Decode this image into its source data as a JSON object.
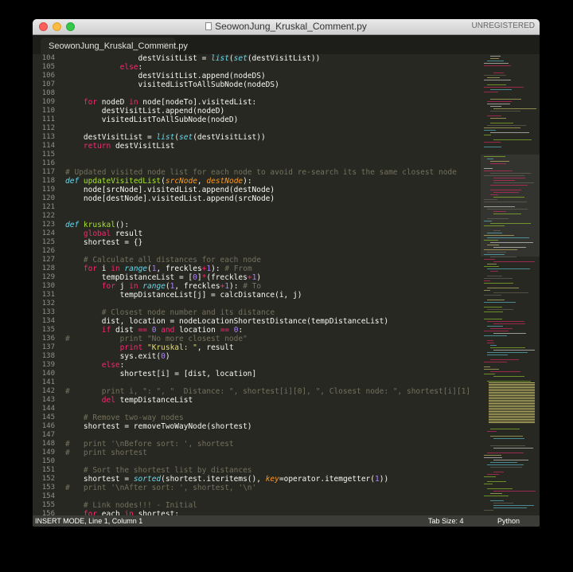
{
  "window": {
    "title": "SeowonJung_Kruskal_Comment.py",
    "unregistered": "UNREGISTERED"
  },
  "tab": {
    "label": "SeowonJung_Kruskal_Comment.py",
    "close_glyph": "×"
  },
  "editor": {
    "theme_colors": {
      "background": "#272822",
      "keyword": "#f92672",
      "function": "#a6e22e",
      "string": "#e6db74",
      "number": "#ae81ff",
      "builtin": "#66d9ef",
      "param": "#fd971f",
      "comment": "#75715e",
      "text": "#f8f8f2"
    },
    "lines": [
      {
        "num": "104",
        "indent": "                ",
        "tokens": [
          [
            "destVisitList = ",
            ""
          ],
          [
            "list",
            "b"
          ],
          [
            "(",
            ""
          ],
          [
            "set",
            "b"
          ],
          [
            "(destVisitList))",
            ""
          ]
        ]
      },
      {
        "num": "105",
        "indent": "            ",
        "tokens": [
          [
            "else",
            "k"
          ],
          [
            ":",
            ""
          ]
        ]
      },
      {
        "num": "106",
        "indent": "                ",
        "tokens": [
          [
            "destVisitList.append(nodeDS)",
            ""
          ]
        ]
      },
      {
        "num": "107",
        "indent": "                ",
        "tokens": [
          [
            "visitedListToAllSubNode(nodeDS)",
            ""
          ]
        ]
      },
      {
        "num": "108",
        "indent": "",
        "tokens": []
      },
      {
        "num": "109",
        "indent": "    ",
        "tokens": [
          [
            "for",
            "k"
          ],
          [
            " nodeD ",
            ""
          ],
          [
            "in",
            "k"
          ],
          [
            " node[nodeTo].visitedList:",
            ""
          ]
        ]
      },
      {
        "num": "110",
        "indent": "        ",
        "tokens": [
          [
            "destVisitList.append(nodeD)",
            ""
          ]
        ]
      },
      {
        "num": "111",
        "indent": "        ",
        "tokens": [
          [
            "visitedListToAllSubNode(nodeD)",
            ""
          ]
        ]
      },
      {
        "num": "112",
        "indent": "",
        "tokens": []
      },
      {
        "num": "113",
        "indent": "    ",
        "tokens": [
          [
            "destVisitList = ",
            ""
          ],
          [
            "list",
            "b"
          ],
          [
            "(",
            ""
          ],
          [
            "set",
            "b"
          ],
          [
            "(destVisitList))",
            ""
          ]
        ]
      },
      {
        "num": "114",
        "indent": "    ",
        "tokens": [
          [
            "return",
            "k"
          ],
          [
            " destVisitList",
            ""
          ]
        ]
      },
      {
        "num": "115",
        "indent": "",
        "tokens": []
      },
      {
        "num": "116",
        "indent": "",
        "tokens": []
      },
      {
        "num": "117",
        "indent": "",
        "tokens": [
          [
            "# Updated visited node list for each node to avoid re-search its the same closest node",
            "c"
          ]
        ]
      },
      {
        "num": "118",
        "indent": "",
        "tokens": [
          [
            "def",
            "b"
          ],
          [
            " ",
            ""
          ],
          [
            "updateVisitedList",
            "f"
          ],
          [
            "(",
            ""
          ],
          [
            "srcNode",
            "p"
          ],
          [
            ", ",
            ""
          ],
          [
            "destNode",
            "p"
          ],
          [
            "):",
            ""
          ]
        ]
      },
      {
        "num": "119",
        "indent": "    ",
        "tokens": [
          [
            "node[srcNode].visitedList.append(destNode)",
            ""
          ]
        ]
      },
      {
        "num": "120",
        "indent": "    ",
        "tokens": [
          [
            "node[destNode].visitedList.append(srcNode)",
            ""
          ]
        ]
      },
      {
        "num": "121",
        "indent": "",
        "tokens": []
      },
      {
        "num": "122",
        "indent": "",
        "tokens": []
      },
      {
        "num": "123",
        "indent": "",
        "tokens": [
          [
            "def",
            "b"
          ],
          [
            " ",
            ""
          ],
          [
            "kruskal",
            "f"
          ],
          [
            "():",
            ""
          ]
        ]
      },
      {
        "num": "124",
        "indent": "    ",
        "tokens": [
          [
            "global",
            "k"
          ],
          [
            " result",
            ""
          ]
        ]
      },
      {
        "num": "125",
        "indent": "    ",
        "tokens": [
          [
            "shortest = {}",
            ""
          ]
        ]
      },
      {
        "num": "126",
        "indent": "",
        "tokens": []
      },
      {
        "num": "127",
        "indent": "    ",
        "tokens": [
          [
            "# Calculate all distances for each node",
            "c"
          ]
        ]
      },
      {
        "num": "128",
        "indent": "    ",
        "tokens": [
          [
            "for",
            "k"
          ],
          [
            " i ",
            ""
          ],
          [
            "in",
            "k"
          ],
          [
            " ",
            ""
          ],
          [
            "range",
            "b"
          ],
          [
            "(",
            ""
          ],
          [
            "1",
            "n"
          ],
          [
            ", freckles",
            ""
          ],
          [
            "+",
            "k"
          ],
          [
            "1",
            "n"
          ],
          [
            "): ",
            ""
          ],
          [
            "# From",
            "c"
          ]
        ]
      },
      {
        "num": "129",
        "indent": "        ",
        "tokens": [
          [
            "tempDistanceList = [",
            ""
          ],
          [
            "0",
            "n"
          ],
          [
            "]",
            ""
          ],
          [
            "*",
            "k"
          ],
          [
            "(freckles",
            ""
          ],
          [
            "+",
            "k"
          ],
          [
            "1",
            "n"
          ],
          [
            ")",
            ""
          ]
        ]
      },
      {
        "num": "130",
        "indent": "        ",
        "tokens": [
          [
            "for",
            "k"
          ],
          [
            " j ",
            ""
          ],
          [
            "in",
            "k"
          ],
          [
            " ",
            ""
          ],
          [
            "range",
            "b"
          ],
          [
            "(",
            ""
          ],
          [
            "1",
            "n"
          ],
          [
            ", freckles",
            ""
          ],
          [
            "+",
            "k"
          ],
          [
            "1",
            "n"
          ],
          [
            "): ",
            ""
          ],
          [
            "# To",
            "c"
          ]
        ]
      },
      {
        "num": "131",
        "indent": "            ",
        "tokens": [
          [
            "tempDistanceList[j] = calcDistance(i, j)",
            ""
          ]
        ]
      },
      {
        "num": "132",
        "indent": "",
        "tokens": []
      },
      {
        "num": "133",
        "indent": "        ",
        "tokens": [
          [
            "# Closest node number and its distance",
            "c"
          ]
        ]
      },
      {
        "num": "134",
        "indent": "        ",
        "tokens": [
          [
            "dist, location = nodeLocationShortestDistance(tempDistanceList)",
            ""
          ]
        ]
      },
      {
        "num": "135",
        "indent": "        ",
        "tokens": [
          [
            "if",
            "k"
          ],
          [
            " dist ",
            ""
          ],
          [
            "==",
            "k"
          ],
          [
            " ",
            ""
          ],
          [
            "0",
            "n"
          ],
          [
            " ",
            ""
          ],
          [
            "and",
            "k"
          ],
          [
            " location ",
            ""
          ],
          [
            "==",
            "k"
          ],
          [
            " ",
            ""
          ],
          [
            "0",
            "n"
          ],
          [
            ":",
            ""
          ]
        ]
      },
      {
        "num": "136",
        "indent": "#           ",
        "tokens": [
          [
            "print \"No more closest node\"",
            "c"
          ]
        ]
      },
      {
        "num": "137",
        "indent": "            ",
        "tokens": [
          [
            "print",
            "k"
          ],
          [
            " ",
            ""
          ],
          [
            "\"Kruskal: \"",
            "s"
          ],
          [
            ", result",
            ""
          ]
        ]
      },
      {
        "num": "138",
        "indent": "            ",
        "tokens": [
          [
            "sys.exit(",
            ""
          ],
          [
            "0",
            "n"
          ],
          [
            ")",
            ""
          ]
        ]
      },
      {
        "num": "139",
        "indent": "        ",
        "tokens": [
          [
            "else",
            "k"
          ],
          [
            ":",
            ""
          ]
        ]
      },
      {
        "num": "140",
        "indent": "            ",
        "tokens": [
          [
            "shortest[i] = [dist, location]",
            ""
          ]
        ]
      },
      {
        "num": "141",
        "indent": "",
        "tokens": []
      },
      {
        "num": "142",
        "indent": "#       ",
        "tokens": [
          [
            "print i, \": \", \"  Distance: \", shortest[i][0], \", Closest node: \", shortest[i][1]",
            "c"
          ]
        ]
      },
      {
        "num": "143",
        "indent": "        ",
        "tokens": [
          [
            "del",
            "k"
          ],
          [
            " tempDistanceList",
            ""
          ]
        ]
      },
      {
        "num": "144",
        "indent": "",
        "tokens": []
      },
      {
        "num": "145",
        "indent": "    ",
        "tokens": [
          [
            "# Remove two-way nodes",
            "c"
          ]
        ]
      },
      {
        "num": "146",
        "indent": "    ",
        "tokens": [
          [
            "shortest = removeTwoWayNode(shortest)",
            ""
          ]
        ]
      },
      {
        "num": "147",
        "indent": "",
        "tokens": []
      },
      {
        "num": "148",
        "indent": "#   ",
        "tokens": [
          [
            "print '\\nBefore sort: ', shortest",
            "c"
          ]
        ]
      },
      {
        "num": "149",
        "indent": "#   ",
        "tokens": [
          [
            "print shortest",
            "c"
          ]
        ]
      },
      {
        "num": "150",
        "indent": "",
        "tokens": []
      },
      {
        "num": "151",
        "indent": "    ",
        "tokens": [
          [
            "# Sort the shortest list by distances",
            "c"
          ]
        ]
      },
      {
        "num": "152",
        "indent": "    ",
        "tokens": [
          [
            "shortest = ",
            ""
          ],
          [
            "sorted",
            "b"
          ],
          [
            "(shortest.iteritems(), ",
            ""
          ],
          [
            "key",
            "p"
          ],
          [
            "=",
            ""
          ],
          [
            "operator.itemgetter(",
            ""
          ],
          [
            "1",
            "n"
          ],
          [
            "))",
            ""
          ]
        ]
      },
      {
        "num": "153",
        "indent": "#   ",
        "tokens": [
          [
            "print '\\nAfter sort: ', shortest, '\\n'",
            "c"
          ]
        ]
      },
      {
        "num": "154",
        "indent": "",
        "tokens": []
      },
      {
        "num": "155",
        "indent": "    ",
        "tokens": [
          [
            "# Link nodes!!! - Initial",
            "c"
          ]
        ]
      },
      {
        "num": "156",
        "indent": "    ",
        "tokens": [
          [
            "for",
            "k"
          ],
          [
            " each ",
            ""
          ],
          [
            "in",
            "k"
          ],
          [
            " shortest:",
            ""
          ]
        ]
      }
    ]
  },
  "status": {
    "mode": "INSERT MODE, Line 1, Column 1",
    "tab_size": "Tab Size: 4",
    "syntax": "Python"
  }
}
